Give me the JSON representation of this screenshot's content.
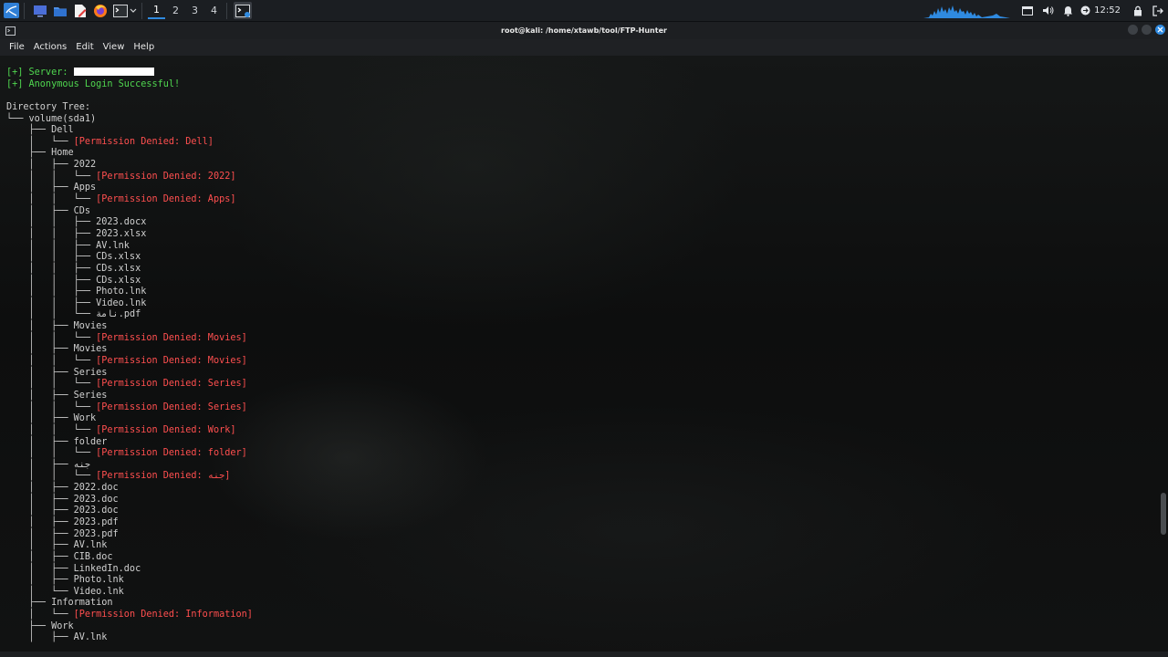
{
  "taskbar": {
    "workspaces": [
      "1",
      "2",
      "3",
      "4"
    ],
    "clock": "12:52",
    "accent": "#2f8ae0"
  },
  "window": {
    "title": "root@kali: /home/xtawb/tool/FTP-Hunter"
  },
  "menu": {
    "items": [
      "File",
      "Actions",
      "Edit",
      "View",
      "Help"
    ]
  },
  "terminal": {
    "lines": [
      {
        "text": "[+] Server: ",
        "color": "green",
        "mask": true
      },
      {
        "text": "[+] Anonymous Login Successful!",
        "color": "green"
      },
      {
        "text": ""
      },
      {
        "text": "Directory Tree:"
      },
      {
        "text": "└── volume(sda1)"
      },
      {
        "text": "    ├── Dell"
      },
      {
        "prefix": "    │   └── ",
        "text": "[Permission Denied: Dell]",
        "color": "red"
      },
      {
        "text": "    ├── Home"
      },
      {
        "text": "    │   ├── 2022"
      },
      {
        "prefix": "    │   │   └── ",
        "text": "[Permission Denied: 2022]",
        "color": "red"
      },
      {
        "text": "    │   ├── Apps"
      },
      {
        "prefix": "    │   │   └── ",
        "text": "[Permission Denied: Apps]",
        "color": "red"
      },
      {
        "text": "    │   ├── CDs"
      },
      {
        "text": "    │   │   ├── 2023.docx"
      },
      {
        "text": "    │   │   ├── 2023.xlsx"
      },
      {
        "text": "    │   │   ├── AV.lnk"
      },
      {
        "text": "    │   │   ├── CDs.xlsx"
      },
      {
        "text": "    │   │   ├── CDs.xlsx"
      },
      {
        "text": "    │   │   ├── CDs.xlsx"
      },
      {
        "text": "    │   │   ├── Photo.lnk"
      },
      {
        "text": "    │   │   ├── Video.lnk"
      },
      {
        "text": "    │   │   └── نامة.pdf"
      },
      {
        "text": "    │   ├── Movies"
      },
      {
        "prefix": "    │   │   └── ",
        "text": "[Permission Denied: Movies]",
        "color": "red"
      },
      {
        "text": "    │   ├── Movies"
      },
      {
        "prefix": "    │   │   └── ",
        "text": "[Permission Denied: Movies]",
        "color": "red"
      },
      {
        "text": "    │   ├── Series"
      },
      {
        "prefix": "    │   │   └── ",
        "text": "[Permission Denied: Series]",
        "color": "red"
      },
      {
        "text": "    │   ├── Series"
      },
      {
        "prefix": "    │   │   └── ",
        "text": "[Permission Denied: Series]",
        "color": "red"
      },
      {
        "text": "    │   ├── Work"
      },
      {
        "prefix": "    │   │   └── ",
        "text": "[Permission Denied: Work]",
        "color": "red"
      },
      {
        "text": "    │   ├── folder"
      },
      {
        "prefix": "    │   │   └── ",
        "text": "[Permission Denied: folder]",
        "color": "red"
      },
      {
        "text": "    │   ├── جنه"
      },
      {
        "prefix": "    │   │   └── ",
        "text": "[Permission Denied: جنه]",
        "color": "red"
      },
      {
        "text": "    │   ├── 2022.doc"
      },
      {
        "text": "    │   ├── 2023.doc"
      },
      {
        "text": "    │   ├── 2023.doc"
      },
      {
        "text": "    │   ├── 2023.pdf"
      },
      {
        "text": "    │   ├── 2023.pdf"
      },
      {
        "text": "    │   ├── AV.lnk"
      },
      {
        "text": "    │   ├── CIB.doc"
      },
      {
        "text": "    │   ├── LinkedIn.doc"
      },
      {
        "text": "    │   ├── Photo.lnk"
      },
      {
        "text": "    │   └── Video.lnk"
      },
      {
        "text": "    ├── Information"
      },
      {
        "prefix": "    │   └── ",
        "text": "[Permission Denied: Information]",
        "color": "red"
      },
      {
        "text": "    ├── Work"
      },
      {
        "text": "    │   ├── AV.lnk"
      }
    ]
  }
}
